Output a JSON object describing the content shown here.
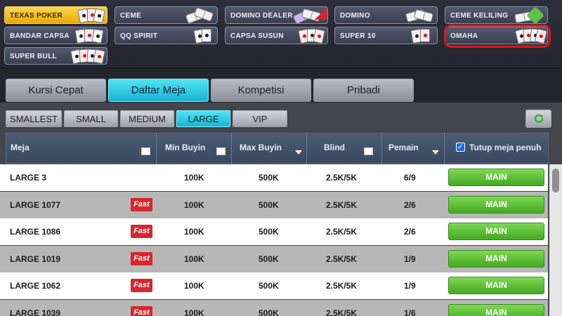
{
  "games": [
    {
      "label": "TEXAS POKER",
      "active": true
    },
    {
      "label": "CEME"
    },
    {
      "label": "DOMINO DEALER"
    },
    {
      "label": "DOMINO"
    },
    {
      "label": "CEME KELILING"
    },
    {
      "label": "BANDAR CAPSA"
    },
    {
      "label": "QQ SPIRIT"
    },
    {
      "label": "CAPSA SUSUN"
    },
    {
      "label": "SUPER 10"
    },
    {
      "label": "OMAHA",
      "highlighted": true
    },
    {
      "label": "SUPER BULL"
    }
  ],
  "main_tabs": [
    {
      "label": "Kursi Cepat"
    },
    {
      "label": "Daftar Meja",
      "active": true
    },
    {
      "label": "Kompetisi"
    },
    {
      "label": "Pribadi"
    }
  ],
  "sub_tabs": [
    {
      "label": "SMALLEST"
    },
    {
      "label": "SMALL"
    },
    {
      "label": "MEDIUM"
    },
    {
      "label": "LARGE",
      "active": true
    },
    {
      "label": "VIP"
    }
  ],
  "table": {
    "headers": {
      "meja": "Meja",
      "min_buyin": "Min Buyin",
      "max_buyin": "Max Buyin",
      "blind": "Blind",
      "pemain": "Pemain",
      "tutup": "Tutup meja penuh"
    },
    "tutup_checked": true,
    "badge_label": "Fast",
    "action_label": "MAIN",
    "rows": [
      {
        "meja": "LARGE 3",
        "fast": false,
        "min": "100K",
        "max": "500K",
        "blind": "2.5K/5K",
        "pemain": "6/9"
      },
      {
        "meja": "LARGE 1077",
        "fast": true,
        "min": "100K",
        "max": "500K",
        "blind": "2.5K/5K",
        "pemain": "2/6"
      },
      {
        "meja": "LARGE 1086",
        "fast": true,
        "min": "100K",
        "max": "500K",
        "blind": "2.5K/5K",
        "pemain": "2/6"
      },
      {
        "meja": "LARGE 1019",
        "fast": true,
        "min": "100K",
        "max": "500K",
        "blind": "2.5K/5K",
        "pemain": "1/9"
      },
      {
        "meja": "LARGE 1062",
        "fast": true,
        "min": "100K",
        "max": "500K",
        "blind": "2.5K/5K",
        "pemain": "1/9"
      },
      {
        "meja": "LARGE 1039",
        "fast": true,
        "min": "100K",
        "max": "500K",
        "blind": "2.5K/5K",
        "pemain": "1/6"
      }
    ]
  },
  "colors": {
    "accent_cyan": "#1bb3d1",
    "active_game_gold": "#e8a70a",
    "play_green": "#43a921",
    "fast_red": "#d8262c",
    "highlight_ring": "#e0151b"
  },
  "icons": {
    "refresh": "refresh-icon",
    "checkbox": "checkbox-icon",
    "sort": "sort-icon"
  }
}
